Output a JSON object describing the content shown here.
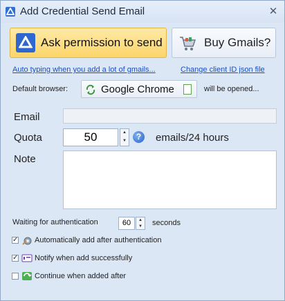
{
  "window": {
    "title": "Add Credential Send Email",
    "close_glyph": "✕"
  },
  "buttons": {
    "ask_label": "Ask permission to send",
    "buy_label": "Buy Gmails?"
  },
  "links": {
    "auto_typing": "Auto typing when you add a lot of gmails...",
    "change_client": "Change client ID json file"
  },
  "browser": {
    "label": "Default browser:",
    "name": "Google Chrome",
    "suffix": "will be opened..."
  },
  "form": {
    "email_label": "Email",
    "email_value": "",
    "quota_label": "Quota",
    "quota_value": "50",
    "quota_unit": "emails/24 hours",
    "help_glyph": "?",
    "note_label": "Note",
    "note_value": ""
  },
  "wait": {
    "label": "Waiting for authentication",
    "value": "60",
    "unit": "seconds"
  },
  "options": [
    {
      "label": "Automatically add after authentication",
      "checked": true
    },
    {
      "label": "Notify when add successfully",
      "checked": true
    },
    {
      "label": "Continue when added after",
      "checked": false
    }
  ],
  "spinner": {
    "up": "▲",
    "down": "▼"
  },
  "colors": {
    "ask_bg": "#fcd56a",
    "link": "#1a4fc4",
    "window_bg": "#dce7f5"
  }
}
